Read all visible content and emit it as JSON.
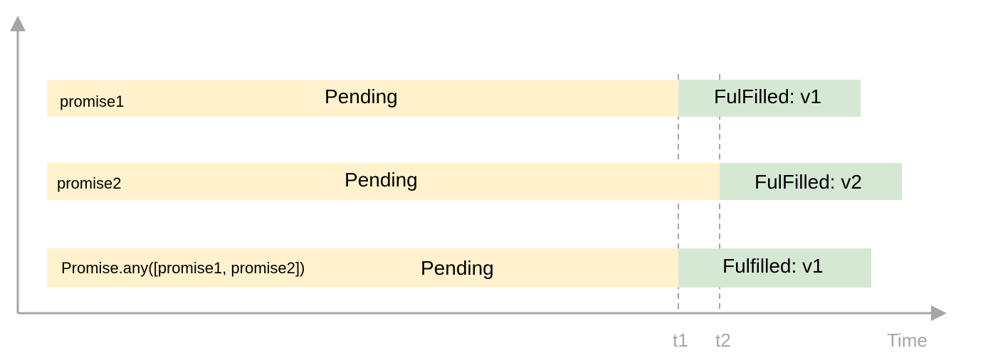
{
  "rows": [
    {
      "label": "promise1",
      "pending_label": "Pending",
      "fulfilled_label": "FulFilled: v1",
      "settled_at": "t1"
    },
    {
      "label": "promise2",
      "pending_label": "Pending",
      "fulfilled_label": "FulFilled: v2",
      "settled_at": "t2"
    },
    {
      "label": "Promise.any([promise1, promise2])",
      "pending_label": "Pending",
      "fulfilled_label": "Fulfilled: v1",
      "settled_at": "t1"
    }
  ],
  "axis": {
    "x_label": "Time",
    "t1_label": "t1",
    "t2_label": "t2"
  },
  "colors": {
    "pending": "#fff2cc",
    "fulfilled": "#d5e8d4",
    "axis": "#a6a6a6",
    "text": "#000000"
  }
}
